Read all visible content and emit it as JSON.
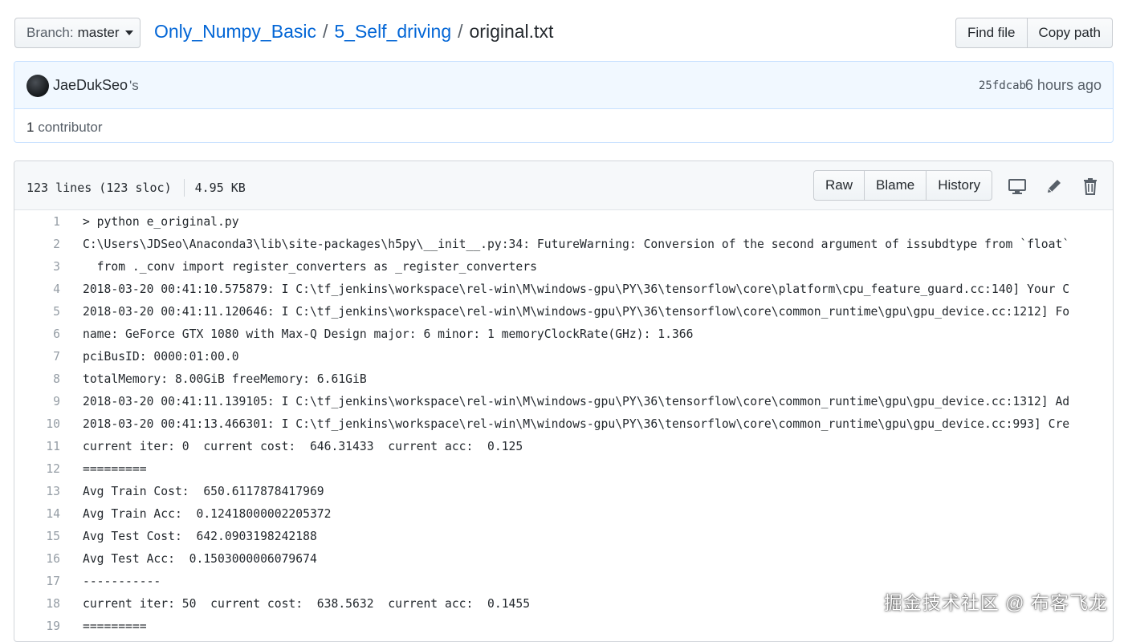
{
  "branch": {
    "label": "Branch:",
    "value": "master"
  },
  "breadcrumb": {
    "repo": "Only_Numpy_Basic",
    "folder": "5_Self_driving",
    "file": "original.txt",
    "separator": "/"
  },
  "file_actions": {
    "find_file": "Find file",
    "copy_path": "Copy path"
  },
  "commit": {
    "author": "JaeDukSeo",
    "author_suffix": "'s",
    "sha": "25fdcab",
    "time": "6 hours ago"
  },
  "contributors": {
    "count": "1",
    "label": "contributor"
  },
  "file_header": {
    "lines": "123 lines (123 sloc)",
    "size": "4.95 KB",
    "raw": "Raw",
    "blame": "Blame",
    "history": "History",
    "icons": [
      "desktop-icon",
      "pencil-icon",
      "trash-icon"
    ]
  },
  "code_lines": [
    {
      "num": "1",
      "text": "> python e_original.py"
    },
    {
      "num": "2",
      "text": "C:\\Users\\JDSeo\\Anaconda3\\lib\\site-packages\\h5py\\__init__.py:34: FutureWarning: Conversion of the second argument of issubdtype from `float`"
    },
    {
      "num": "3",
      "text": "  from ._conv import register_converters as _register_converters"
    },
    {
      "num": "4",
      "text": "2018-03-20 00:41:10.575879: I C:\\tf_jenkins\\workspace\\rel-win\\M\\windows-gpu\\PY\\36\\tensorflow\\core\\platform\\cpu_feature_guard.cc:140] Your C"
    },
    {
      "num": "5",
      "text": "2018-03-20 00:41:11.120646: I C:\\tf_jenkins\\workspace\\rel-win\\M\\windows-gpu\\PY\\36\\tensorflow\\core\\common_runtime\\gpu\\gpu_device.cc:1212] Fo"
    },
    {
      "num": "6",
      "text": "name: GeForce GTX 1080 with Max-Q Design major: 6 minor: 1 memoryClockRate(GHz): 1.366"
    },
    {
      "num": "7",
      "text": "pciBusID: 0000:01:00.0"
    },
    {
      "num": "8",
      "text": "totalMemory: 8.00GiB freeMemory: 6.61GiB"
    },
    {
      "num": "9",
      "text": "2018-03-20 00:41:11.139105: I C:\\tf_jenkins\\workspace\\rel-win\\M\\windows-gpu\\PY\\36\\tensorflow\\core\\common_runtime\\gpu\\gpu_device.cc:1312] Ad"
    },
    {
      "num": "10",
      "text": "2018-03-20 00:41:13.466301: I C:\\tf_jenkins\\workspace\\rel-win\\M\\windows-gpu\\PY\\36\\tensorflow\\core\\common_runtime\\gpu\\gpu_device.cc:993] Cre"
    },
    {
      "num": "11",
      "text": "current iter: 0  current cost:  646.31433  current acc:  0.125"
    },
    {
      "num": "12",
      "text": "========="
    },
    {
      "num": "13",
      "text": "Avg Train Cost:  650.6117878417969"
    },
    {
      "num": "14",
      "text": "Avg Train Acc:  0.12418000002205372"
    },
    {
      "num": "15",
      "text": "Avg Test Cost:  642.0903198242188"
    },
    {
      "num": "16",
      "text": "Avg Test Acc:  0.1503000006079674"
    },
    {
      "num": "17",
      "text": "-----------"
    },
    {
      "num": "18",
      "text": "current iter: 50  current cost:  638.5632  current acc:  0.1455"
    },
    {
      "num": "19",
      "text": "========="
    }
  ],
  "watermark": "掘金技术社区 @ 布客飞龙"
}
